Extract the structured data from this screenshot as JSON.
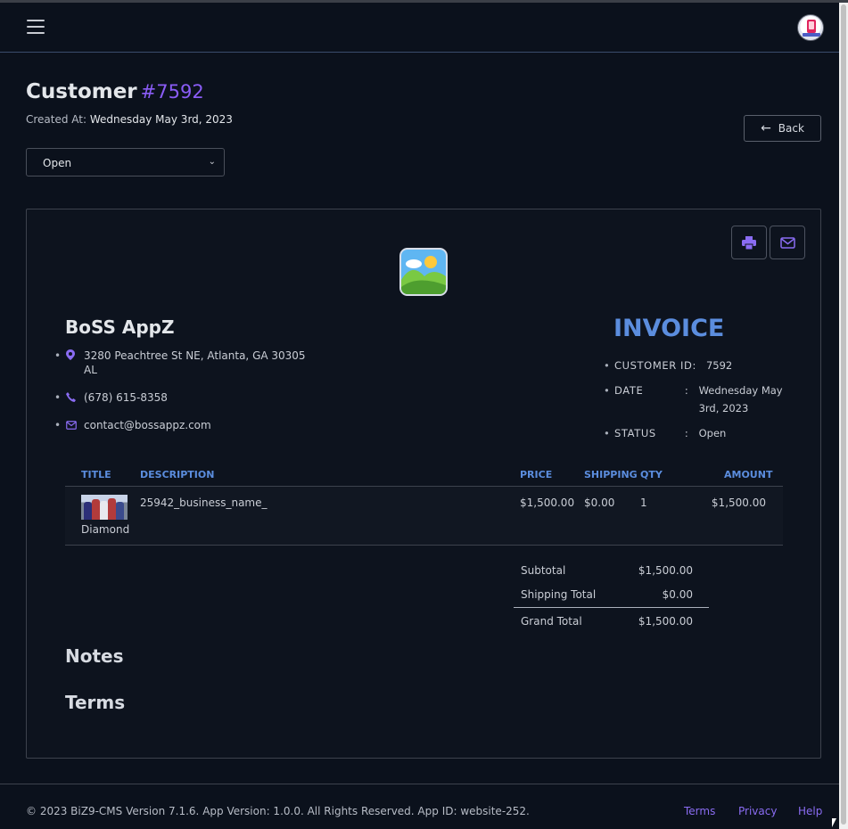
{
  "header": {
    "menu_icon": "hamburger-icon",
    "avatar_icon": "boss-appz-avatar"
  },
  "page": {
    "title": "Customer",
    "number": "#7592",
    "created_label": "Created At:",
    "created_value": "Wednesday May 3rd, 2023",
    "status_value": "Open",
    "back_label": "Back"
  },
  "invoice": {
    "print_icon": "printer-icon",
    "email_icon": "mail-icon",
    "logo_icon": "image-placeholder-icon",
    "company": {
      "name": "BoSS AppZ",
      "address": "3280 Peachtree St NE, Atlanta, GA 30305 AL",
      "phone": "(678) 615-8358",
      "email": "contact@bossappz.com"
    },
    "heading": "INVOICE",
    "customer_id_label": "CUSTOMER ID:",
    "customer_id_value": "7592",
    "date_label": "DATE",
    "date_value": "Wednesday May 3rd, 2023",
    "status_label": "STATUS",
    "status_value": "Open",
    "colon": ":",
    "columns": [
      "TITLE",
      "DESCRIPTION",
      "PRICE",
      "SHIPPING",
      "QTY",
      "AMOUNT"
    ],
    "items": [
      {
        "title": "Diamond",
        "description": "25942_business_name_",
        "price": "$1,500.00",
        "shipping": "$0.00",
        "qty": "1",
        "amount": "$1,500.00"
      }
    ],
    "totals": {
      "subtotal_label": "Subtotal",
      "subtotal_value": "$1,500.00",
      "shipping_label": "Shipping Total",
      "shipping_value": "$0.00",
      "grand_label": "Grand Total",
      "grand_value": "$1,500.00"
    },
    "notes_heading": "Notes",
    "terms_heading": "Terms"
  },
  "footer": {
    "copyright": "© 2023 BiZ9-CMS Version 7.1.6. App Version: 1.0.0. All Rights Reserved. App ID: website-252.",
    "links": [
      "Terms",
      "Privacy",
      "Help"
    ]
  },
  "colors": {
    "accent": "#8a5cf6",
    "invoice_blue": "#5b8dde",
    "background": "#0b111c"
  }
}
